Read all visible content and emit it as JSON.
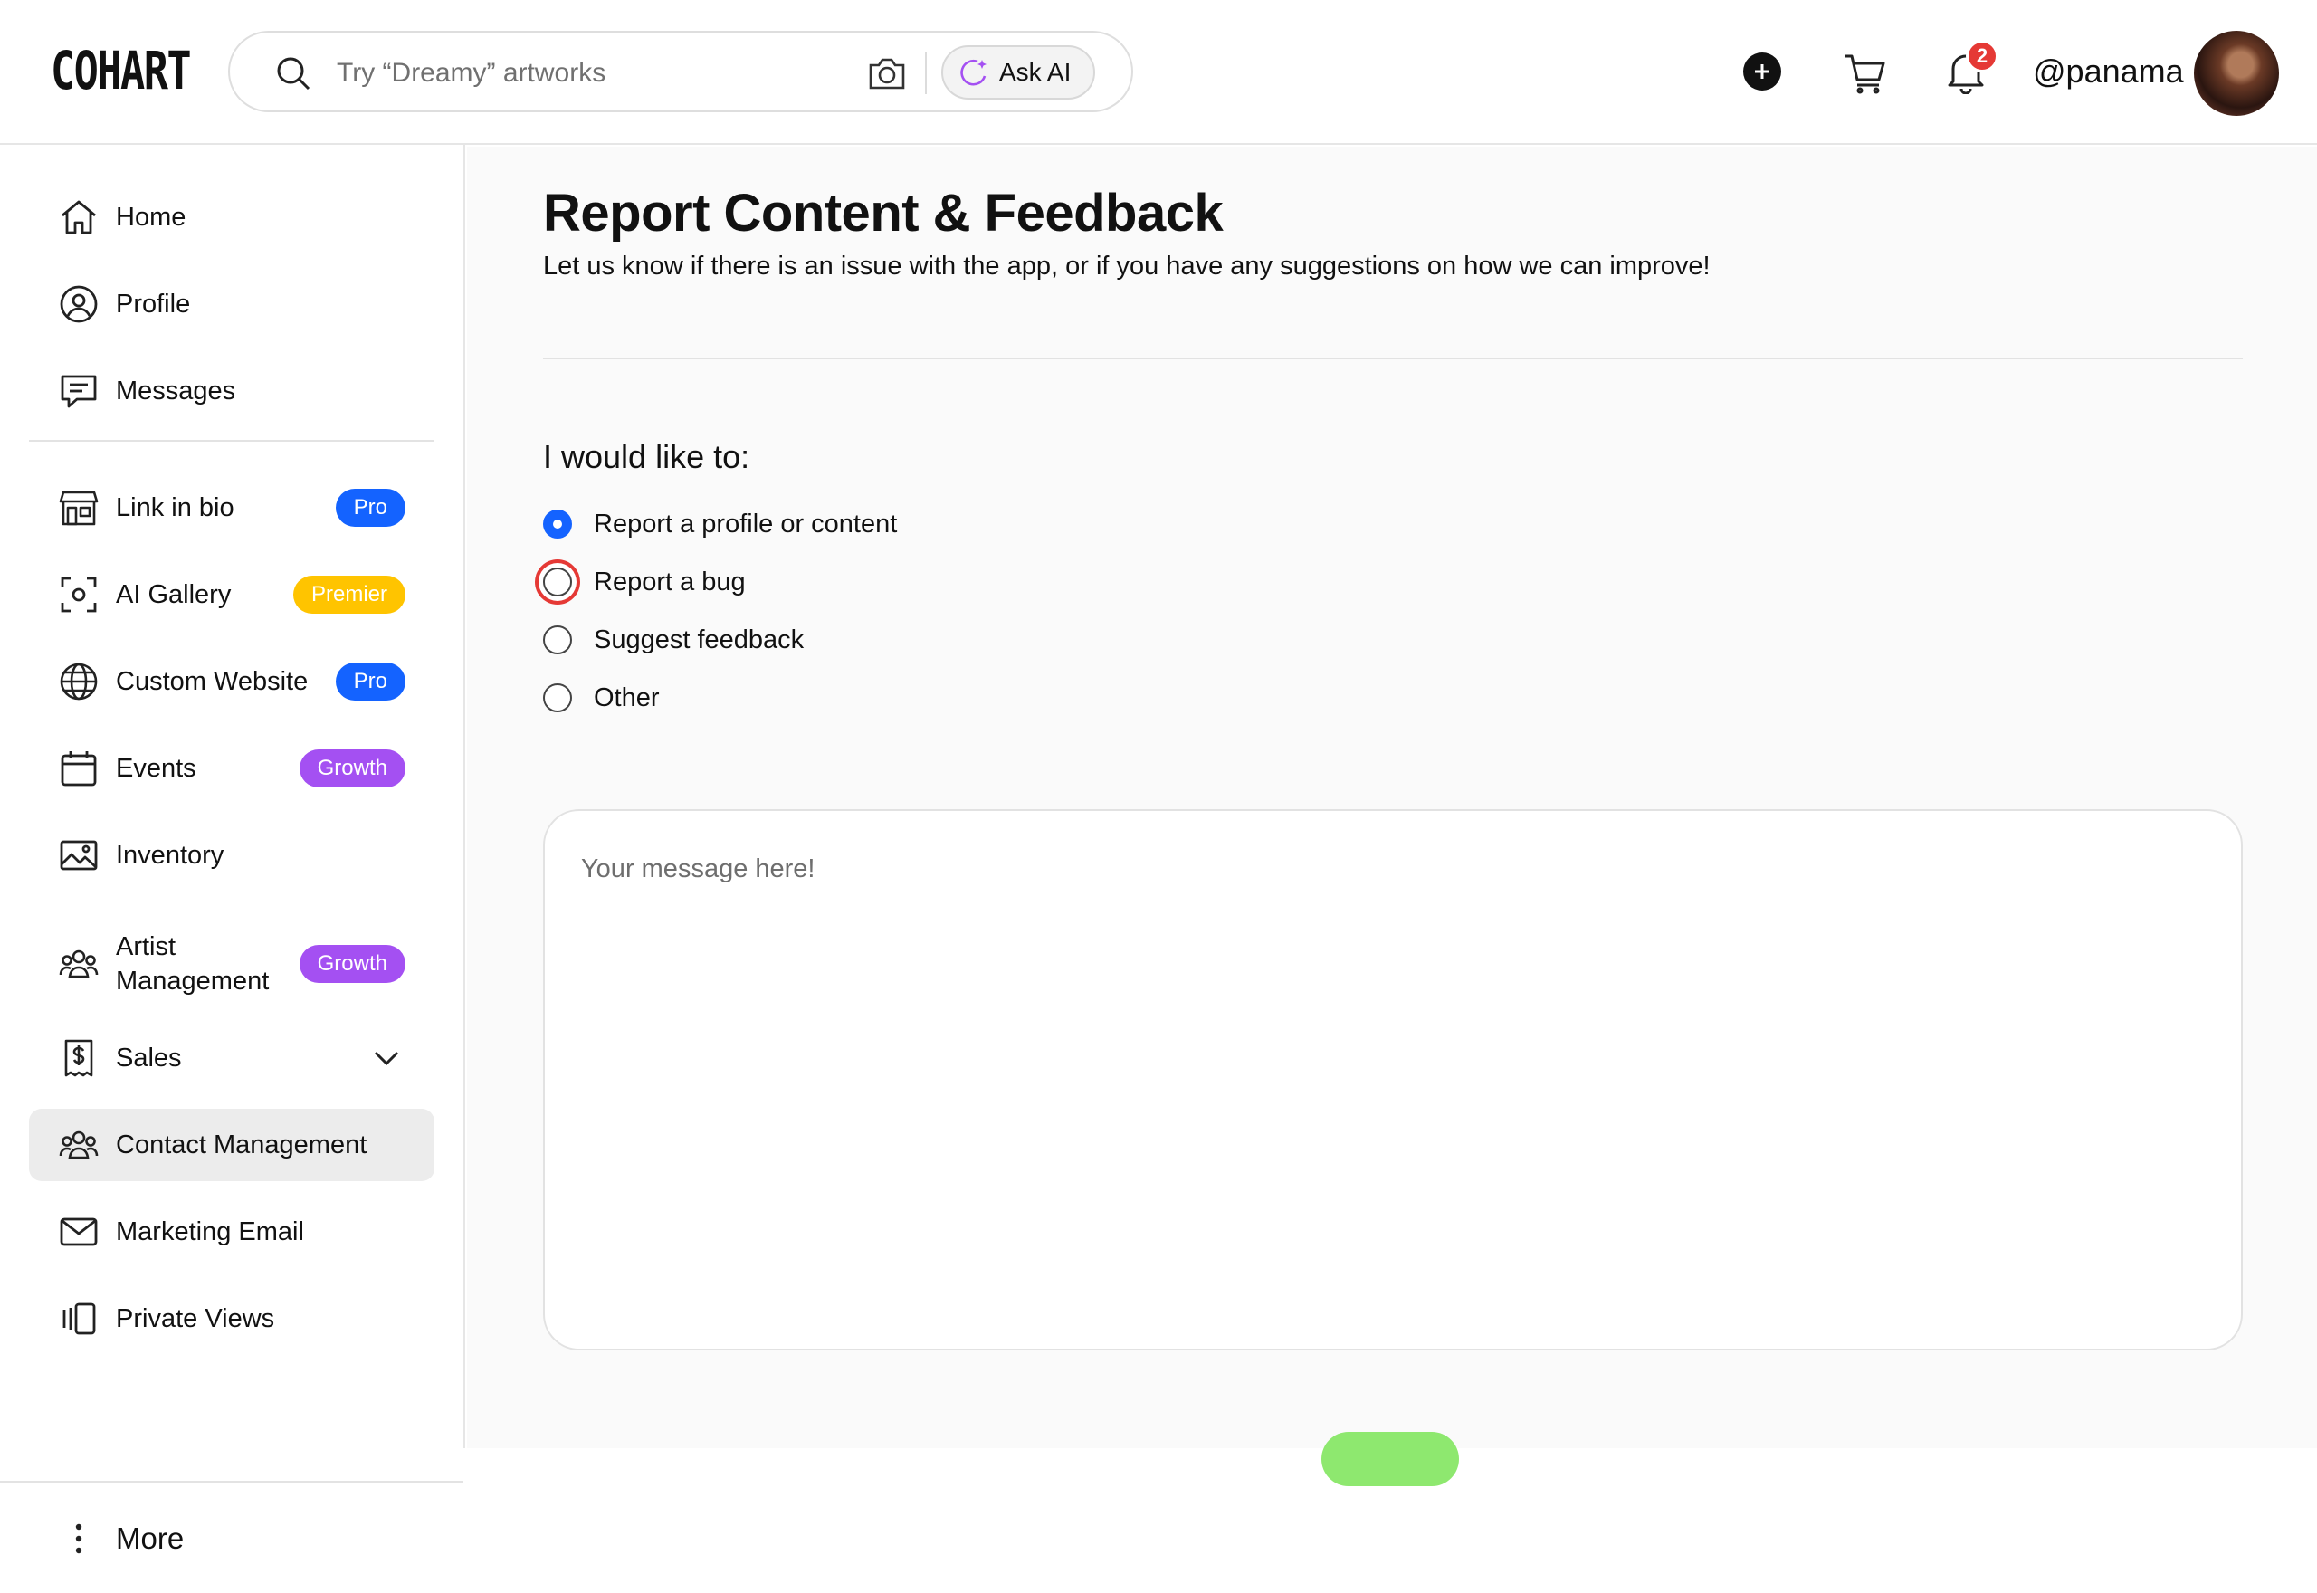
{
  "brand": {
    "logo_text": "COHART"
  },
  "search": {
    "placeholder": "Try “Dreamy” artworks",
    "ask_ai_label": "Ask AI"
  },
  "header": {
    "notification_count": "2",
    "username": "@panama"
  },
  "colors": {
    "accent_blue": "#1463ff",
    "premier_yellow": "#ffc400",
    "growth_purple": "#a450f2",
    "notification_red": "#e53935",
    "submit_green": "#8ee86f"
  },
  "sidebar": {
    "primary": [
      {
        "label": "Home",
        "icon": "home-icon"
      },
      {
        "label": "Profile",
        "icon": "user-circle-icon"
      },
      {
        "label": "Messages",
        "icon": "chat-icon"
      }
    ],
    "features": [
      {
        "label": "Link in bio",
        "icon": "storefront-icon",
        "badge": "Pro"
      },
      {
        "label": "AI Gallery",
        "icon": "scan-icon",
        "badge": "Premier"
      },
      {
        "label": "Custom Website",
        "icon": "globe-icon",
        "badge": "Pro"
      },
      {
        "label": "Events",
        "icon": "calendar-icon",
        "badge": "Growth"
      },
      {
        "label": "Inventory",
        "icon": "image-icon"
      },
      {
        "label": "Artist Management",
        "icon": "users-icon",
        "badge": "Growth"
      },
      {
        "label": "Sales",
        "icon": "receipt-dollar-icon"
      },
      {
        "label": "Contact Management",
        "icon": "users-icon",
        "active": true
      },
      {
        "label": "Marketing Email",
        "icon": "mail-icon"
      },
      {
        "label": "Private Views",
        "icon": "carousel-icon"
      }
    ],
    "more_label": "More"
  },
  "main": {
    "title": "Report Content & Feedback",
    "subtitle": "Let us know if there is an issue with the app, or if you have any suggestions on how we can improve!",
    "question": "I would like to:",
    "options": [
      {
        "label": "Report a profile or content",
        "selected": true
      },
      {
        "label": "Report a bug",
        "selected": false,
        "focused": true
      },
      {
        "label": "Suggest feedback",
        "selected": false
      },
      {
        "label": "Other",
        "selected": false
      }
    ],
    "message_placeholder": "Your message here!"
  }
}
